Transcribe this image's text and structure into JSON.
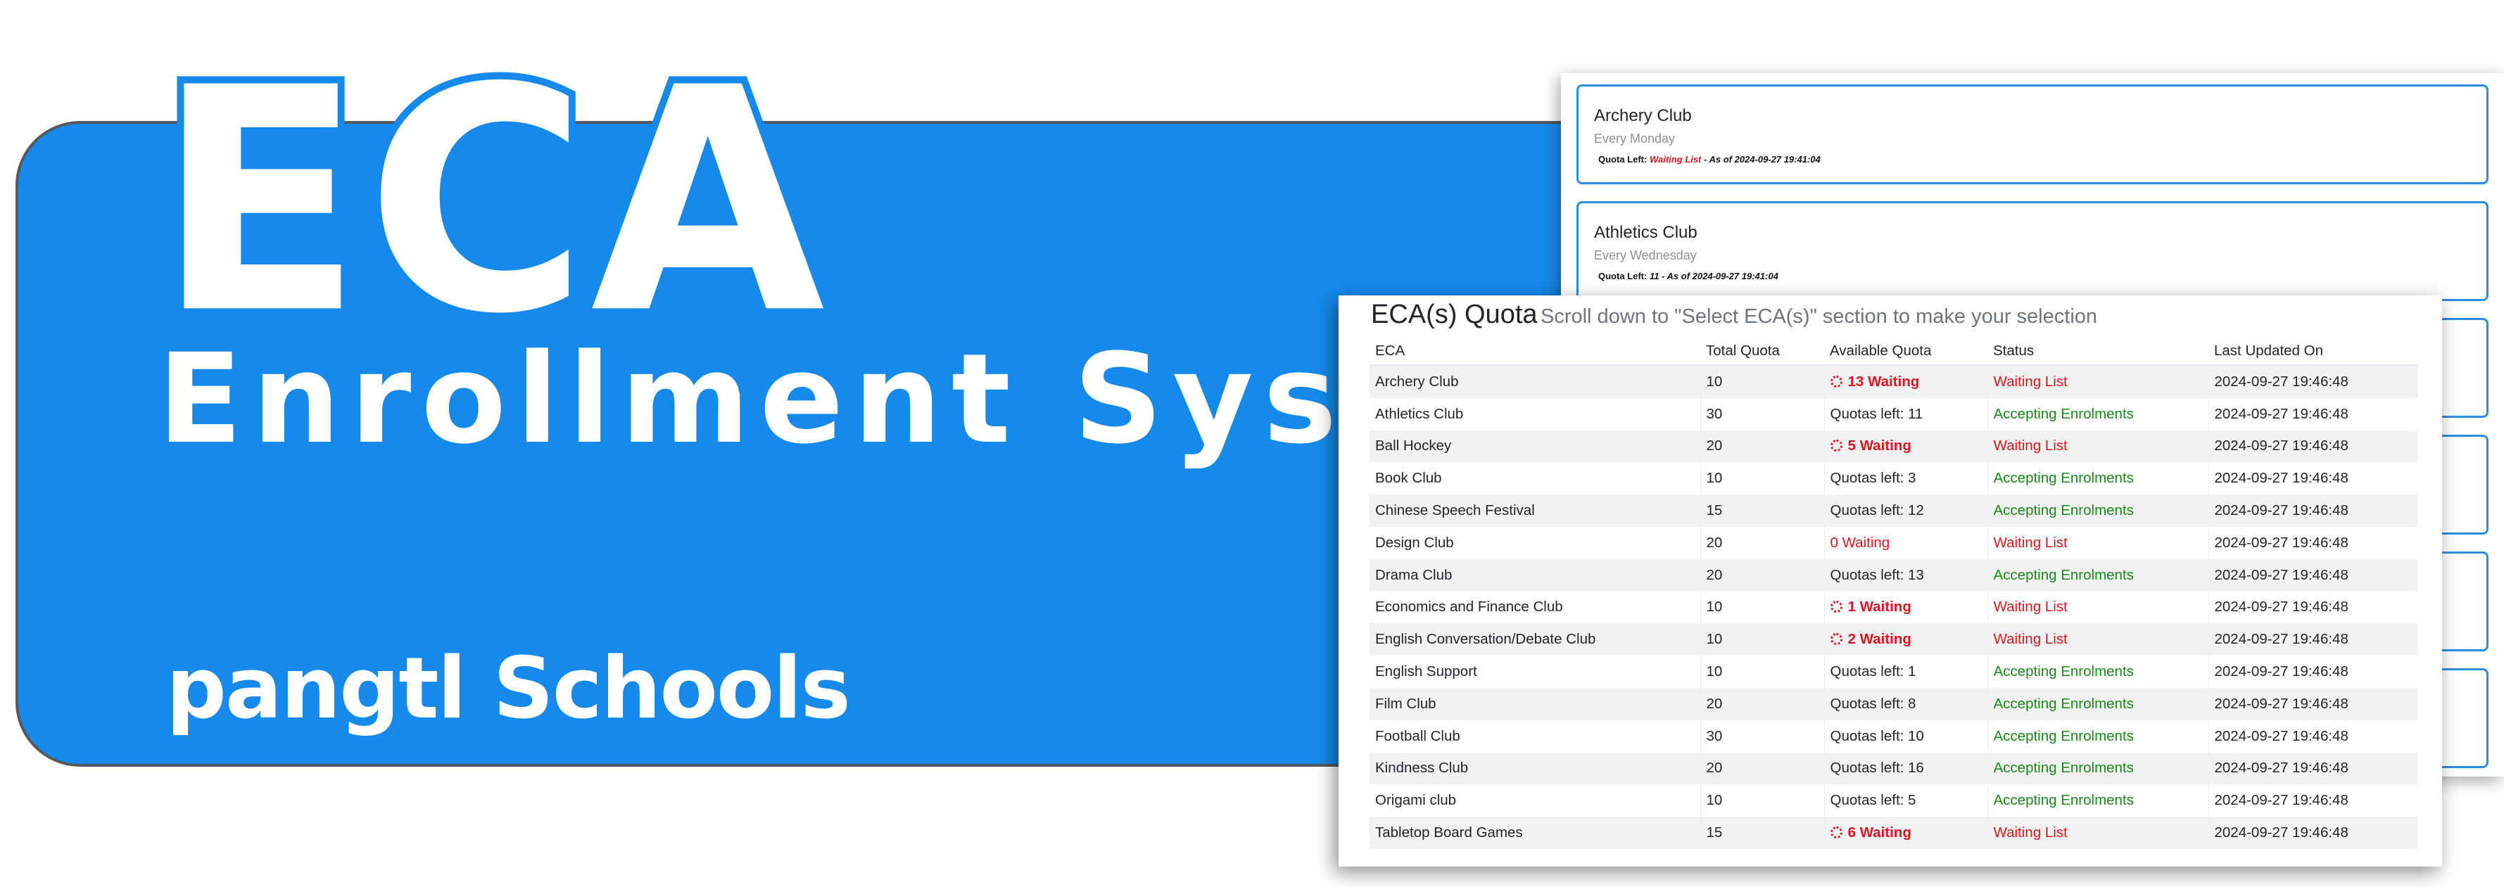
{
  "banner": {
    "title": "ECA",
    "subtitle": "Enrollment System",
    "school": "pangtl Schools"
  },
  "colors": {
    "banner_blue": "#168aeb",
    "card_border": "#2b8de6",
    "accepting_green": "#188a18",
    "waiting_red": "#e0141e"
  },
  "club_cards": [
    {
      "name": "Archery Club",
      "schedule": "Every Monday",
      "quota_label": "Quota Left:",
      "quota_value": "Waiting List",
      "quota_waiting": true,
      "as_of": "- As of 2024-09-27 19:41:04"
    },
    {
      "name": "Athletics Club",
      "schedule": "Every Wednesday",
      "quota_label": "Quota Left:",
      "quota_value": "11",
      "quota_waiting": false,
      "as_of": "- As of 2024-09-27 19:41:04"
    },
    {
      "name": "",
      "schedule": "",
      "quota_label": "",
      "quota_value": "",
      "quota_waiting": false,
      "as_of": ""
    },
    {
      "name": "",
      "schedule": "",
      "quota_label": "",
      "quota_value": "",
      "quota_waiting": false,
      "as_of": ""
    },
    {
      "name": "",
      "schedule": "",
      "quota_label": "",
      "quota_value": "",
      "quota_waiting": false,
      "as_of": ""
    },
    {
      "name": "",
      "schedule": "",
      "quota_label": "",
      "quota_value": "",
      "quota_waiting": false,
      "as_of": ""
    }
  ],
  "quota": {
    "title": "ECA(s) Quota",
    "subtitle": "Scroll down to \"Select ECA(s)\" section to make your selection",
    "columns": [
      "ECA",
      "Total Quota",
      "Available Quota",
      "Status",
      "Last Updated On"
    ],
    "rows": [
      {
        "eca": "Archery Club",
        "total": "10",
        "available": "13 Waiting",
        "avail_style": "wait-bold",
        "status": "Waiting List",
        "status_style": "wait",
        "updated": "2024-09-27 19:46:48"
      },
      {
        "eca": "Athletics Club",
        "total": "30",
        "available": "Quotas left: 11",
        "avail_style": "normal",
        "status": "Accepting Enrolments",
        "status_style": "accept",
        "updated": "2024-09-27 19:46:48"
      },
      {
        "eca": "Ball Hockey",
        "total": "20",
        "available": "5 Waiting",
        "avail_style": "wait-bold",
        "status": "Waiting List",
        "status_style": "wait",
        "updated": "2024-09-27 19:46:48"
      },
      {
        "eca": "Book Club",
        "total": "10",
        "available": "Quotas left: 3",
        "avail_style": "normal",
        "status": "Accepting Enrolments",
        "status_style": "accept",
        "updated": "2024-09-27 19:46:48"
      },
      {
        "eca": "Chinese Speech Festival",
        "total": "15",
        "available": "Quotas left: 12",
        "avail_style": "normal",
        "status": "Accepting Enrolments",
        "status_style": "accept",
        "updated": "2024-09-27 19:46:48"
      },
      {
        "eca": "Design Club",
        "total": "20",
        "available": "0 Waiting",
        "avail_style": "wait-plain",
        "status": "Waiting List",
        "status_style": "wait",
        "updated": "2024-09-27 19:46:48"
      },
      {
        "eca": "Drama Club",
        "total": "20",
        "available": "Quotas left: 13",
        "avail_style": "normal",
        "status": "Accepting Enrolments",
        "status_style": "accept",
        "updated": "2024-09-27 19:46:48"
      },
      {
        "eca": "Economics and Finance Club",
        "total": "10",
        "available": "1 Waiting",
        "avail_style": "wait-bold",
        "status": "Waiting List",
        "status_style": "wait",
        "updated": "2024-09-27 19:46:48"
      },
      {
        "eca": "English Conversation/Debate Club",
        "total": "10",
        "available": "2 Waiting",
        "avail_style": "wait-bold",
        "status": "Waiting List",
        "status_style": "wait",
        "updated": "2024-09-27 19:46:48"
      },
      {
        "eca": "English Support",
        "total": "10",
        "available": "Quotas left: 1",
        "avail_style": "normal",
        "status": "Accepting Enrolments",
        "status_style": "accept",
        "updated": "2024-09-27 19:46:48"
      },
      {
        "eca": "Film Club",
        "total": "20",
        "available": "Quotas left: 8",
        "avail_style": "normal",
        "status": "Accepting Enrolments",
        "status_style": "accept",
        "updated": "2024-09-27 19:46:48"
      },
      {
        "eca": "Football Club",
        "total": "30",
        "available": "Quotas left: 10",
        "avail_style": "normal",
        "status": "Accepting Enrolments",
        "status_style": "accept",
        "updated": "2024-09-27 19:46:48"
      },
      {
        "eca": "Kindness Club",
        "total": "20",
        "available": "Quotas left: 16",
        "avail_style": "normal",
        "status": "Accepting Enrolments",
        "status_style": "accept",
        "updated": "2024-09-27 19:46:48"
      },
      {
        "eca": "Origami club",
        "total": "10",
        "available": "Quotas left: 5",
        "avail_style": "normal",
        "status": "Accepting Enrolments",
        "status_style": "accept",
        "updated": "2024-09-27 19:46:48"
      },
      {
        "eca": "Tabletop Board Games",
        "total": "15",
        "available": "6 Waiting",
        "avail_style": "wait-bold",
        "status": "Waiting List",
        "status_style": "wait",
        "updated": "2024-09-27 19:46:48"
      }
    ]
  }
}
